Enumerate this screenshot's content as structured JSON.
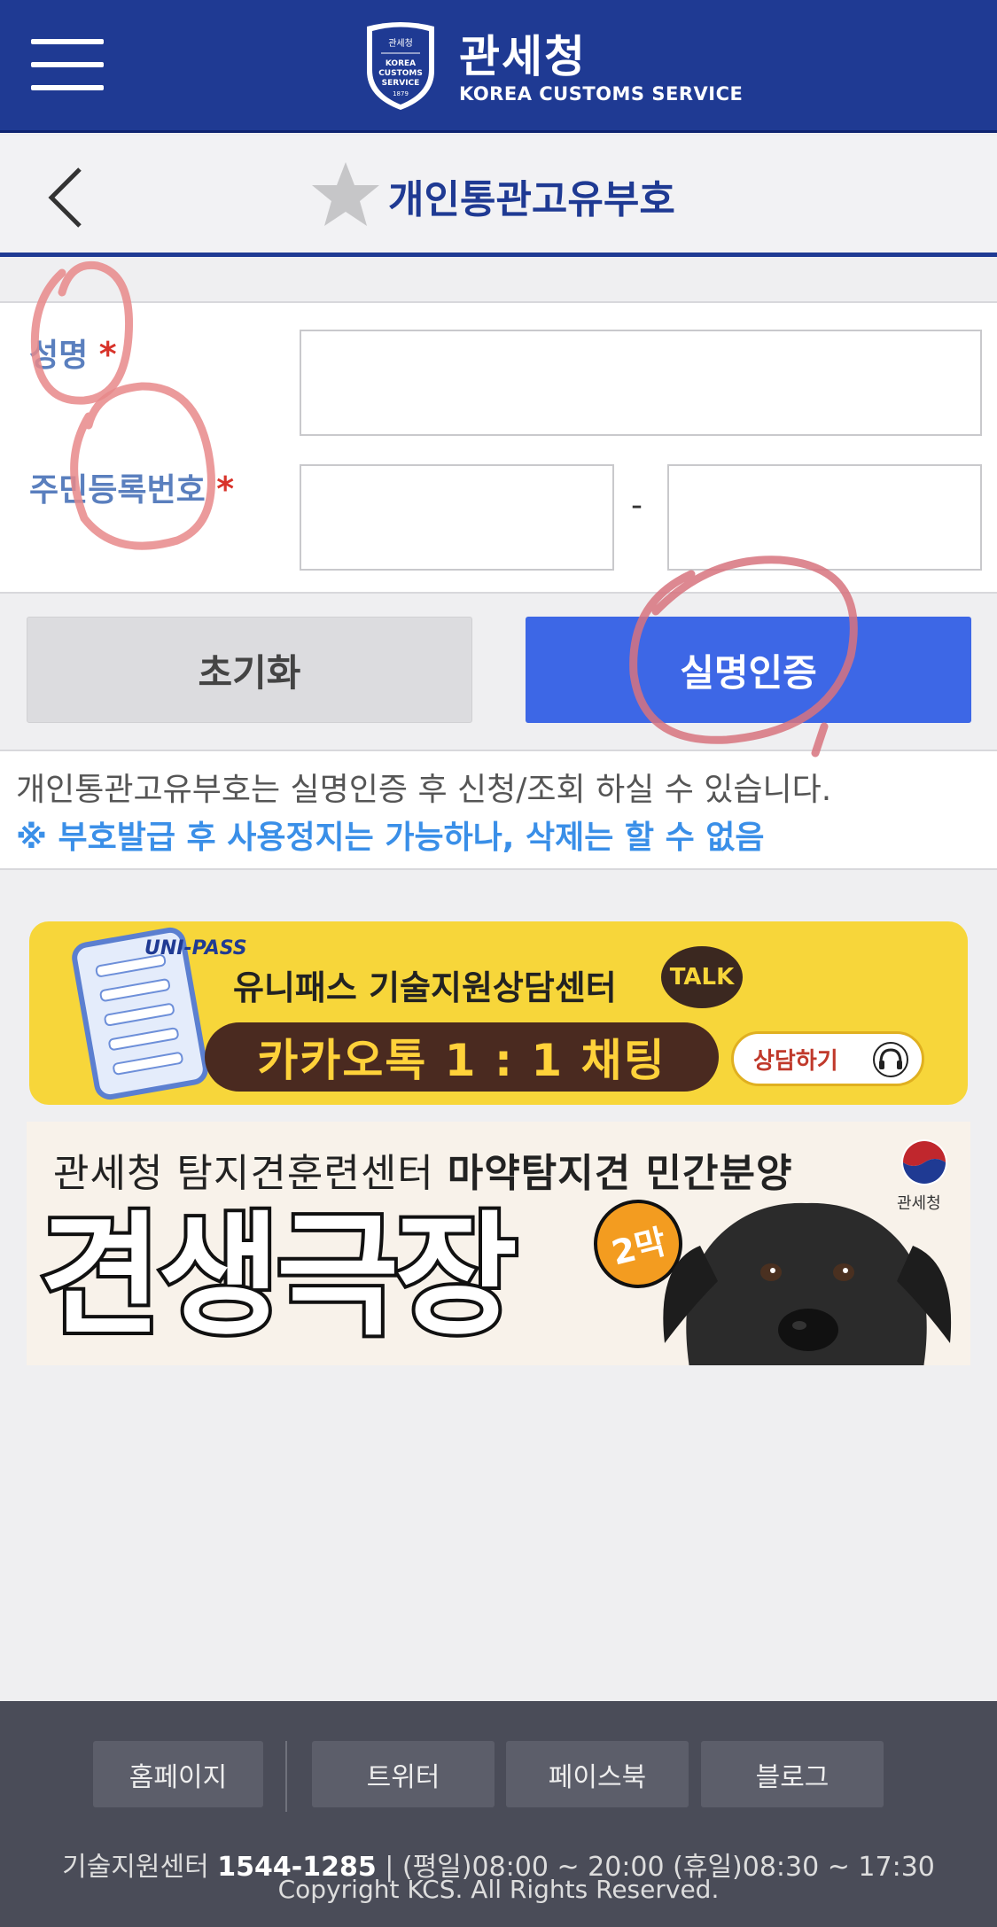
{
  "header": {
    "brand_ko": "관세청",
    "brand_en": "KOREA CUSTOMS SERVICE",
    "emblem_top": "관세청",
    "emblem_text": [
      "KOREA",
      "CUSTOMS",
      "SERVICE"
    ],
    "emblem_year": "1879",
    "menu_icon": "hamburger-menu-icon",
    "colors": {
      "primary": "#1f3a93",
      "accent": "#3d67e6"
    }
  },
  "titlebar": {
    "title": "개인통관고유부호",
    "back_icon": "chevron-left-icon",
    "star_icon": "star-icon"
  },
  "form": {
    "name_label": "성명",
    "rrn_label": "주민등록번호",
    "required_mark": "*",
    "dash": "-",
    "name_value": "",
    "rrn_front_value": "",
    "rrn_back_value": ""
  },
  "buttons": {
    "reset": "초기화",
    "verify": "실명인증"
  },
  "info": {
    "line1": "개인통관고유부호는 실명인증 후 신청/조회 하실 수 있습니다.",
    "line2": "※ 부호발급 후 사용정지는 가능하나, 삭제는 할 수 없음"
  },
  "banner1": {
    "brand": "UNI-PASS",
    "title": "유니패스 기술지원상담센터",
    "talk_badge": "TALK",
    "pill": "카카오톡 1 : 1 채팅",
    "consult_button": "상담하기"
  },
  "banner2": {
    "line_plain": "관세청 탐지견훈련센터 ",
    "line_bold": "마약탐지견 민간분양",
    "big": "견생극장",
    "badge": "2막",
    "logo_text": "관세청"
  },
  "footer": {
    "links": [
      "홈페이지",
      "트위터",
      "페이스북",
      "블로그"
    ],
    "support_label": "기술지원센터 ",
    "support_number": "1544-1285",
    "support_hours": " | (평일)08:00 ~ 20:00 (휴일)08:30 ~ 17:30",
    "copyright": "Copyright KCS. All Rights Reserved."
  }
}
